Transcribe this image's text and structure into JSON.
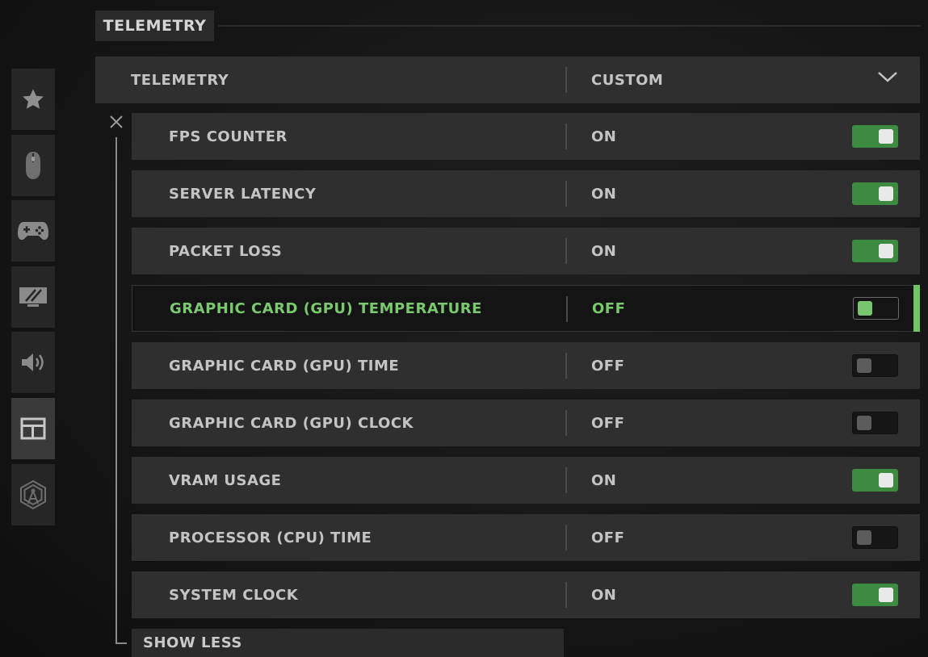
{
  "section": {
    "title": "TELEMETRY"
  },
  "sidebar": {
    "items": [
      {
        "name": "favorites",
        "icon": "star-icon"
      },
      {
        "name": "mouse",
        "icon": "mouse-icon"
      },
      {
        "name": "controller",
        "icon": "gamepad-icon"
      },
      {
        "name": "graphics",
        "icon": "monitor-icon"
      },
      {
        "name": "audio",
        "icon": "speaker-icon"
      },
      {
        "name": "interface",
        "icon": "interface-layout-icon",
        "active": true
      },
      {
        "name": "account-network",
        "icon": "network-icon"
      }
    ]
  },
  "telemetry": {
    "label": "TELEMETRY",
    "value": "CUSTOM"
  },
  "settings": [
    {
      "label": "FPS COUNTER",
      "value": "ON",
      "on": true
    },
    {
      "label": "SERVER LATENCY",
      "value": "ON",
      "on": true
    },
    {
      "label": "PACKET LOSS",
      "value": "ON",
      "on": true
    },
    {
      "label": "GRAPHIC CARD (GPU) TEMPERATURE",
      "value": "OFF",
      "on": false,
      "focused": true
    },
    {
      "label": "GRAPHIC CARD (GPU) TIME",
      "value": "OFF",
      "on": false
    },
    {
      "label": "GRAPHIC CARD (GPU) CLOCK",
      "value": "OFF",
      "on": false
    },
    {
      "label": "VRAM USAGE",
      "value": "ON",
      "on": true
    },
    {
      "label": "PROCESSOR (CPU) TIME",
      "value": "OFF",
      "on": false
    },
    {
      "label": "SYSTEM CLOCK",
      "value": "ON",
      "on": true
    }
  ],
  "show_less": "SHOW LESS",
  "colors": {
    "accent_green": "#70c465",
    "toggle_on": "#3d8a41",
    "row_bg": "#2f2f2f"
  }
}
